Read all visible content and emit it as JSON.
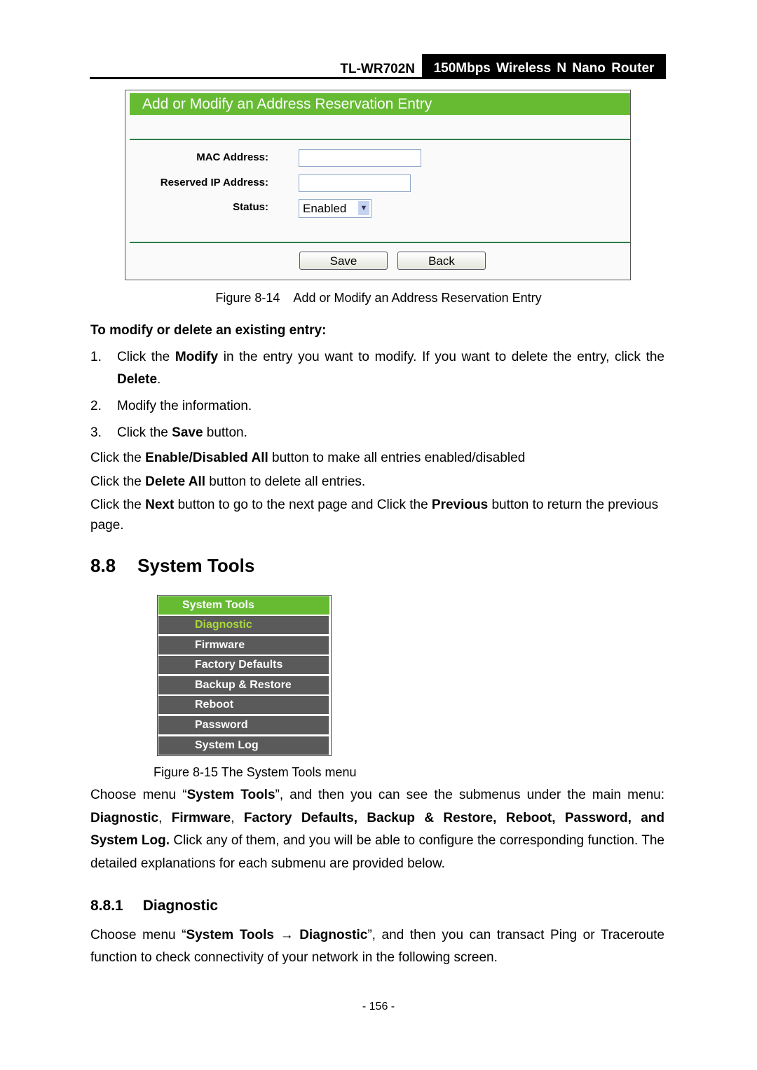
{
  "header": {
    "model": "TL-WR702N",
    "product": "150Mbps  Wireless  N  Nano  Router"
  },
  "form": {
    "title": "Add or Modify an Address Reservation Entry",
    "mac_label": "MAC Address:",
    "mac_value": "",
    "ip_label": "Reserved IP Address:",
    "ip_value": "",
    "status_label": "Status:",
    "status_value": "Enabled",
    "save": "Save",
    "back": "Back",
    "accent": "#66bb33"
  },
  "caption1": "Figure 8-14    Add or Modify an Address Reservation Entry",
  "subhead": "To modify or delete an existing entry:",
  "list": [
    {
      "num": "1.",
      "segs": [
        {
          "t": "Click the "
        },
        {
          "t": "Modify",
          "b": true
        },
        {
          "t": " in the entry you want to modify. If you want to delete the entry, click the "
        },
        {
          "t": "Delete",
          "b": true
        },
        {
          "t": "."
        }
      ]
    },
    {
      "num": "2.",
      "segs": [
        {
          "t": "Modify the information."
        }
      ]
    },
    {
      "num": "3.",
      "segs": [
        {
          "t": "Click the "
        },
        {
          "t": "Save",
          "b": true
        },
        {
          "t": " button."
        }
      ]
    }
  ],
  "paras1": [
    [
      {
        "t": "Click the "
      },
      {
        "t": "Enable/Disabled All",
        "b": true
      },
      {
        "t": " button to make all entries enabled/disabled"
      }
    ],
    [
      {
        "t": "Click the "
      },
      {
        "t": "Delete All",
        "b": true
      },
      {
        "t": " button to delete all entries."
      }
    ],
    [
      {
        "t": "Click the "
      },
      {
        "t": "Next",
        "b": true
      },
      {
        "t": " button to go to the next page and Click the "
      },
      {
        "t": "Previous",
        "b": true
      },
      {
        "t": " button to return the previous page."
      }
    ]
  ],
  "section": {
    "num": "8.8",
    "title": "System Tools"
  },
  "menu": {
    "header": "System Tools",
    "items": [
      "Diagnostic",
      "Firmware",
      "Factory Defaults",
      "Backup & Restore",
      "Reboot",
      "Password",
      "System Log"
    ],
    "active": "Diagnostic"
  },
  "caption2": "Figure 8-15 The System Tools menu",
  "para2": [
    {
      "t": "Choose menu “"
    },
    {
      "t": "System Tools",
      "b": true
    },
    {
      "t": "”, and then you can see the submenus under the main menu: "
    },
    {
      "t": "Diagnostic",
      "b": true
    },
    {
      "t": ", "
    },
    {
      "t": "Firmware",
      "b": true
    },
    {
      "t": ", "
    },
    {
      "t": "Factory Defaults, Backup & Restore, Reboot, Password, and System Log.",
      "b": true
    },
    {
      "t": " Click any of them, and you will be able to configure the corresponding function. The detailed explanations for each submenu are provided below."
    }
  ],
  "subsection": {
    "num": "8.8.1",
    "title": "Diagnostic"
  },
  "para3": [
    {
      "t": "Choose menu “"
    },
    {
      "t": "System Tools → Diagnostic",
      "b": true
    },
    {
      "t": "”, and then you can transact Ping or Traceroute function to check connectivity of your network in the following screen."
    }
  ],
  "page_number": "- 156 -"
}
